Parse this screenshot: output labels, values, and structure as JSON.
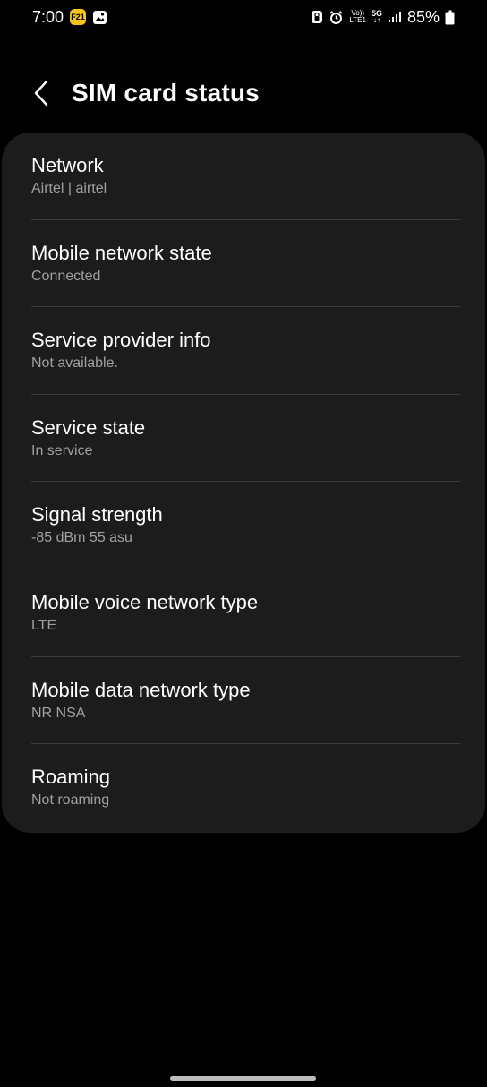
{
  "status_bar": {
    "time": "7:00",
    "notification_badge": "F21",
    "icons": [
      "f21-badge-icon",
      "gallery-icon",
      "lock-icon",
      "alarm-icon",
      "volte-icon",
      "5g-icon",
      "signal-icon",
      "battery-icon"
    ],
    "volte_top": "Vo))",
    "volte_bottom": "LTE1",
    "network_top": "5G",
    "network_bottom": "↓↑",
    "battery": "85%"
  },
  "header": {
    "title": "SIM card status"
  },
  "items": [
    {
      "title": "Network",
      "value": "Airtel | airtel"
    },
    {
      "title": "Mobile network state",
      "value": "Connected"
    },
    {
      "title": "Service provider info",
      "value": "Not available."
    },
    {
      "title": "Service state",
      "value": "In service"
    },
    {
      "title": "Signal strength",
      "value": "-85 dBm 55 asu"
    },
    {
      "title": "Mobile voice network type",
      "value": "LTE"
    },
    {
      "title": "Mobile data network type",
      "value": "NR NSA"
    },
    {
      "title": "Roaming",
      "value": "Not roaming"
    }
  ],
  "colors": {
    "background": "#000000",
    "card": "#1c1c1c",
    "divider": "#3a3a3a",
    "secondary_text": "#a0a0a0",
    "badge": "#f5c518"
  }
}
